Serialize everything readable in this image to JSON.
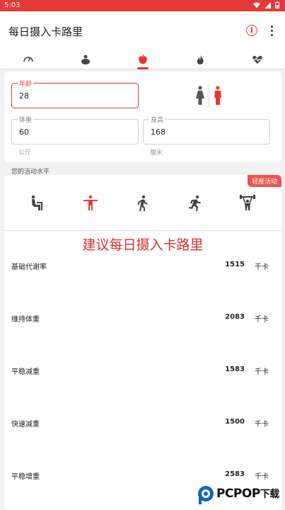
{
  "status": {
    "time": "5:03"
  },
  "app": {
    "title": "每日摄入卡路里"
  },
  "tabs": [
    {
      "icon": "speedometer-icon"
    },
    {
      "icon": "body-weight-icon"
    },
    {
      "icon": "apple-icon",
      "active": true
    },
    {
      "icon": "flame-icon"
    },
    {
      "icon": "heart-rate-icon"
    }
  ],
  "form": {
    "age": {
      "label": "年龄",
      "value": "28"
    },
    "weight": {
      "label": "体重",
      "value": "60",
      "unit": "公斤"
    },
    "height": {
      "label": "身高",
      "value": "168",
      "unit": "厘米"
    },
    "gender_selected": "female"
  },
  "activity": {
    "section_label": "您的活动水平",
    "badge": "轻度活动",
    "levels": [
      "sedentary-icon",
      "light-activity-icon",
      "walking-icon",
      "running-icon",
      "weightlifting-icon"
    ],
    "selected_index": 1
  },
  "results": {
    "heading": "建议每日摄入卡路里",
    "unit": "千卡",
    "rows": [
      {
        "name": "基础代谢率",
        "value": "1515"
      },
      {
        "name": "维持体重",
        "value": "2083"
      },
      {
        "name": "平稳减重",
        "value": "1583"
      },
      {
        "name": "快速减重",
        "value": "1500"
      },
      {
        "name": "平稳增重",
        "value": "2583"
      }
    ]
  },
  "watermark": {
    "brand": "PCPOP",
    "suffix": "下载"
  },
  "colors": {
    "accent": "#e53935"
  }
}
